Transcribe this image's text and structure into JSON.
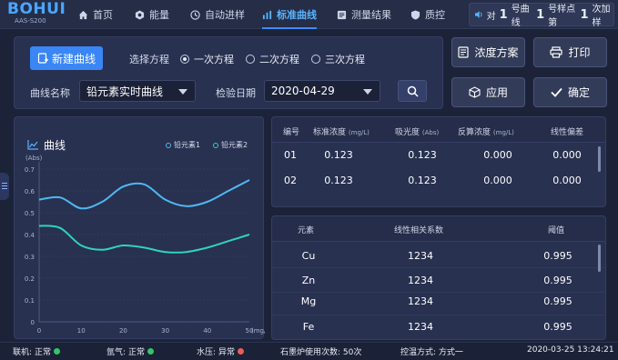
{
  "header": {
    "logo": "BOHUI",
    "model": "AAS-S200",
    "tabs": [
      {
        "label": "首页",
        "icon": "home-icon"
      },
      {
        "label": "能量",
        "icon": "energy-icon"
      },
      {
        "label": "自动进样",
        "icon": "autosampler-icon"
      },
      {
        "label": "标准曲线",
        "icon": "chart-icon",
        "active": true
      },
      {
        "label": "测量结果",
        "icon": "result-icon"
      },
      {
        "label": "质控",
        "icon": "shield-icon"
      }
    ],
    "notice": {
      "p1": "对",
      "n1": "1",
      "p2": "号曲线",
      "n2": "1",
      "p3": "号样点第",
      "n3": "1",
      "p4": "次加样"
    }
  },
  "toolbar": {
    "new_curve": "新建曲线",
    "equation_label": "选择方程",
    "equations": [
      "一次方程",
      "二次方程",
      "三次方程"
    ],
    "selected_equation": 0,
    "curve_name_label": "曲线名称",
    "curve_name": "铅元素实时曲线",
    "date_label": "检验日期",
    "date": "2020-04-29"
  },
  "actions": {
    "concentration_plan": "浓度方案",
    "print": "打印",
    "apply": "应用",
    "confirm": "确定"
  },
  "chart_data": {
    "type": "line",
    "title": "曲线",
    "ylabel": "(Abs)",
    "xlabel": "(mg/L)",
    "xlim": [
      0,
      50
    ],
    "ylim": [
      0,
      0.7
    ],
    "x_ticks": [
      0,
      10,
      20,
      30,
      40,
      50
    ],
    "y_ticks": [
      0,
      0.1,
      0.2,
      0.3,
      0.4,
      0.5,
      0.6,
      0.7
    ],
    "y_tick_labels": [
      "0",
      "0.1",
      "0.2",
      "0.3",
      "0.4",
      "0.5",
      "0.6",
      "0.7"
    ],
    "x_tick_labels": [
      "0",
      "10",
      "20",
      "30",
      "40",
      "50"
    ],
    "grid": true,
    "series": [
      {
        "name": "铅元素1",
        "color": "#4fb8f2",
        "x": [
          0,
          5,
          10,
          15,
          20,
          25,
          30,
          35,
          40,
          45,
          50
        ],
        "values": [
          0.56,
          0.57,
          0.52,
          0.55,
          0.62,
          0.63,
          0.56,
          0.53,
          0.55,
          0.6,
          0.65
        ]
      },
      {
        "name": "铅元素2",
        "color": "#2fd3c1",
        "x": [
          0,
          5,
          10,
          15,
          20,
          25,
          30,
          35,
          40,
          45,
          50
        ],
        "values": [
          0.44,
          0.43,
          0.35,
          0.33,
          0.35,
          0.34,
          0.32,
          0.32,
          0.34,
          0.37,
          0.4
        ]
      }
    ]
  },
  "table1": {
    "headers": [
      "编号",
      "标准浓度",
      "(mg/L)",
      "吸光度",
      "(Abs)",
      "反算浓度",
      "(mg/L)",
      "线性偏差"
    ],
    "rows": [
      [
        "01",
        "0.123",
        "0.123",
        "0.000",
        "0.000"
      ],
      [
        "02",
        "0.123",
        "0.123",
        "0.000",
        "0.000"
      ]
    ]
  },
  "table2": {
    "headers": [
      "元素",
      "线性相关系数",
      "阈值"
    ],
    "rows": [
      [
        "Cu",
        "1234",
        "0.995"
      ],
      [
        "Zn",
        "1234",
        "0.995"
      ],
      [
        "Mg",
        "1234",
        "0.995"
      ],
      [
        "Fe",
        "1234",
        "0.995"
      ]
    ]
  },
  "status": {
    "online_label": "联机:",
    "online_value": "正常",
    "online_color": "#35c46a",
    "argon_label": "氩气:",
    "argon_value": "正常",
    "argon_color": "#35c46a",
    "water_label": "水压:",
    "water_value": "异常",
    "water_color": "#ef5a5a",
    "furnace": "石墨炉使用次数: 50次",
    "temp_ctrl": "控温方式: 方式一",
    "datetime": "2020-03-25 13:24:21"
  }
}
